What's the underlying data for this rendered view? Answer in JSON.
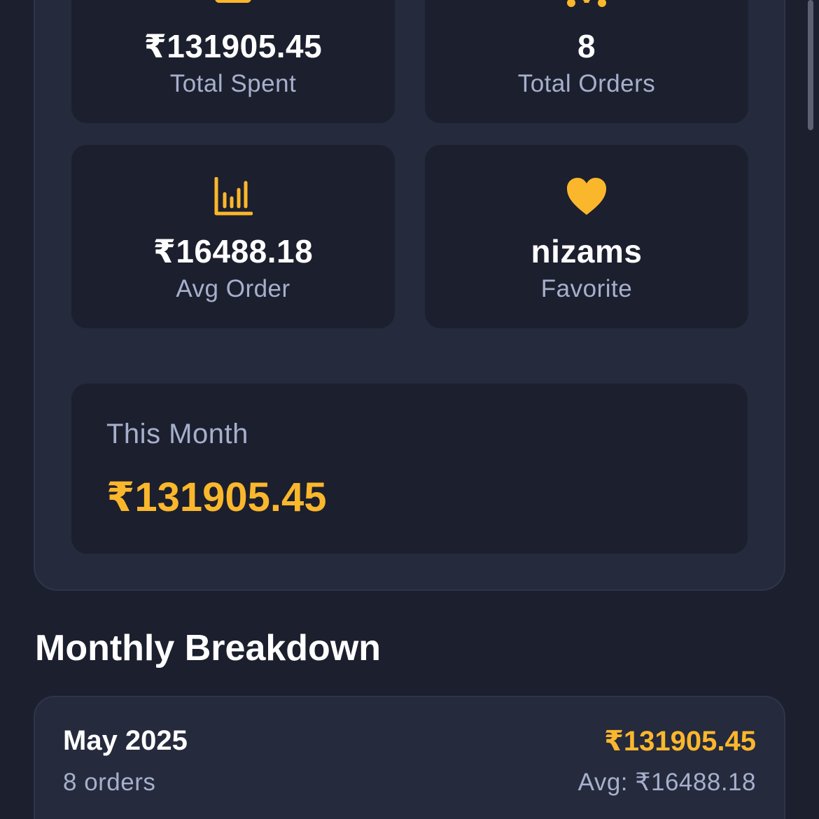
{
  "stats": {
    "total_spent": {
      "value": "₹131905.45",
      "label": "Total Spent",
      "icon": "wallet-icon"
    },
    "total_orders": {
      "value": "8",
      "label": "Total Orders",
      "icon": "utensils-icon"
    },
    "avg_order": {
      "value": "₹16488.18",
      "label": "Avg Order",
      "icon": "bar-chart-icon"
    },
    "favorite": {
      "value": "nizams",
      "label": "Favorite",
      "icon": "heart-icon"
    }
  },
  "this_month": {
    "label": "This Month",
    "value": "₹131905.45"
  },
  "monthly_breakdown": {
    "title": "Monthly Breakdown",
    "items": [
      {
        "month": "May 2025",
        "orders": "8 orders",
        "total": "₹131905.45",
        "avg": "Avg: ₹16488.18"
      }
    ]
  },
  "colors": {
    "accent": "#fbb72c",
    "background": "#1c1f2e",
    "card": "#252a3d",
    "muted_text": "#a6b0cc"
  }
}
